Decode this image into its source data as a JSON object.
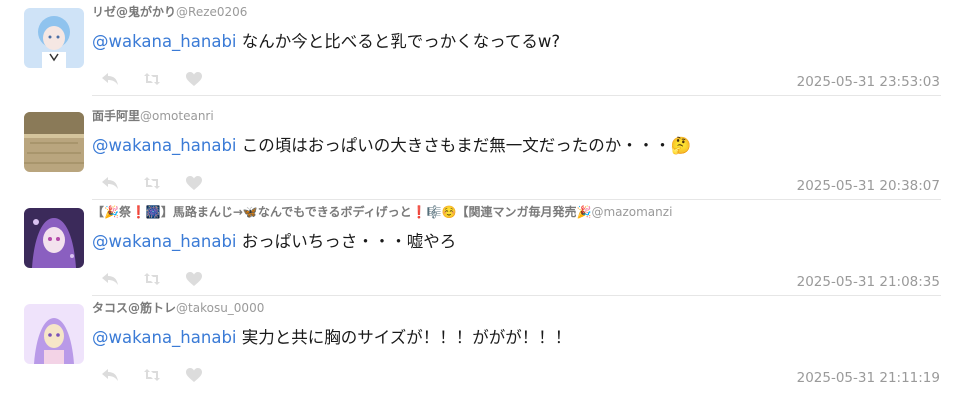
{
  "replies": [
    {
      "display_name": "リゼ@鬼がかり",
      "handle": "@Reze0206",
      "mention": "@wakana_hanabi",
      "text": " なんか今と比べると乳でっかくなってるw?",
      "timestamp": "2025-05-31 23:53:03",
      "avatar_colors": [
        "#cfe3f7",
        "#8fc3ee",
        "#f5e7e3"
      ]
    },
    {
      "display_name": "面手阿里",
      "handle": "@omoteanri",
      "mention": "@wakana_hanabi",
      "text": " この頃はおっぱいの大きさもまだ無一文だったのか・・・🤔",
      "timestamp": "2025-05-31 20:38:07",
      "avatar_colors": [
        "#b9a57e",
        "#8a7a58",
        "#d4c49c"
      ]
    },
    {
      "display_name": "【🎉祭❗🎆】馬路まんじ→🦋なんでもできるボディげっと❗🎼☺️【関連マンガ毎月発売🎉",
      "handle": "@mazomanzi",
      "mention": "@wakana_hanabi",
      "text": " おっぱいちっさ・・・嘘やろ",
      "timestamp": "2025-05-31 21:08:35",
      "avatar_colors": [
        "#3b2a5a",
        "#8a5fc0",
        "#d9c2f0"
      ]
    },
    {
      "display_name": "タコス@筋トレ",
      "handle": "@takosu_0000",
      "mention": "@wakana_hanabi",
      "text": " 実力と共に胸のサイズが！！！ががが！！！",
      "timestamp": "2025-05-31 21:11:19",
      "avatar_colors": [
        "#efe3fb",
        "#b99ae8",
        "#f6e6c8"
      ]
    }
  ],
  "icons": {
    "reply": "reply-icon",
    "retweet": "retweet-icon",
    "like": "heart-icon"
  },
  "colors": {
    "mention": "#3b7bd6",
    "muted_text": "#9a9a9a",
    "icon": "#dcdcdc",
    "divider": "#e6e6e6"
  }
}
